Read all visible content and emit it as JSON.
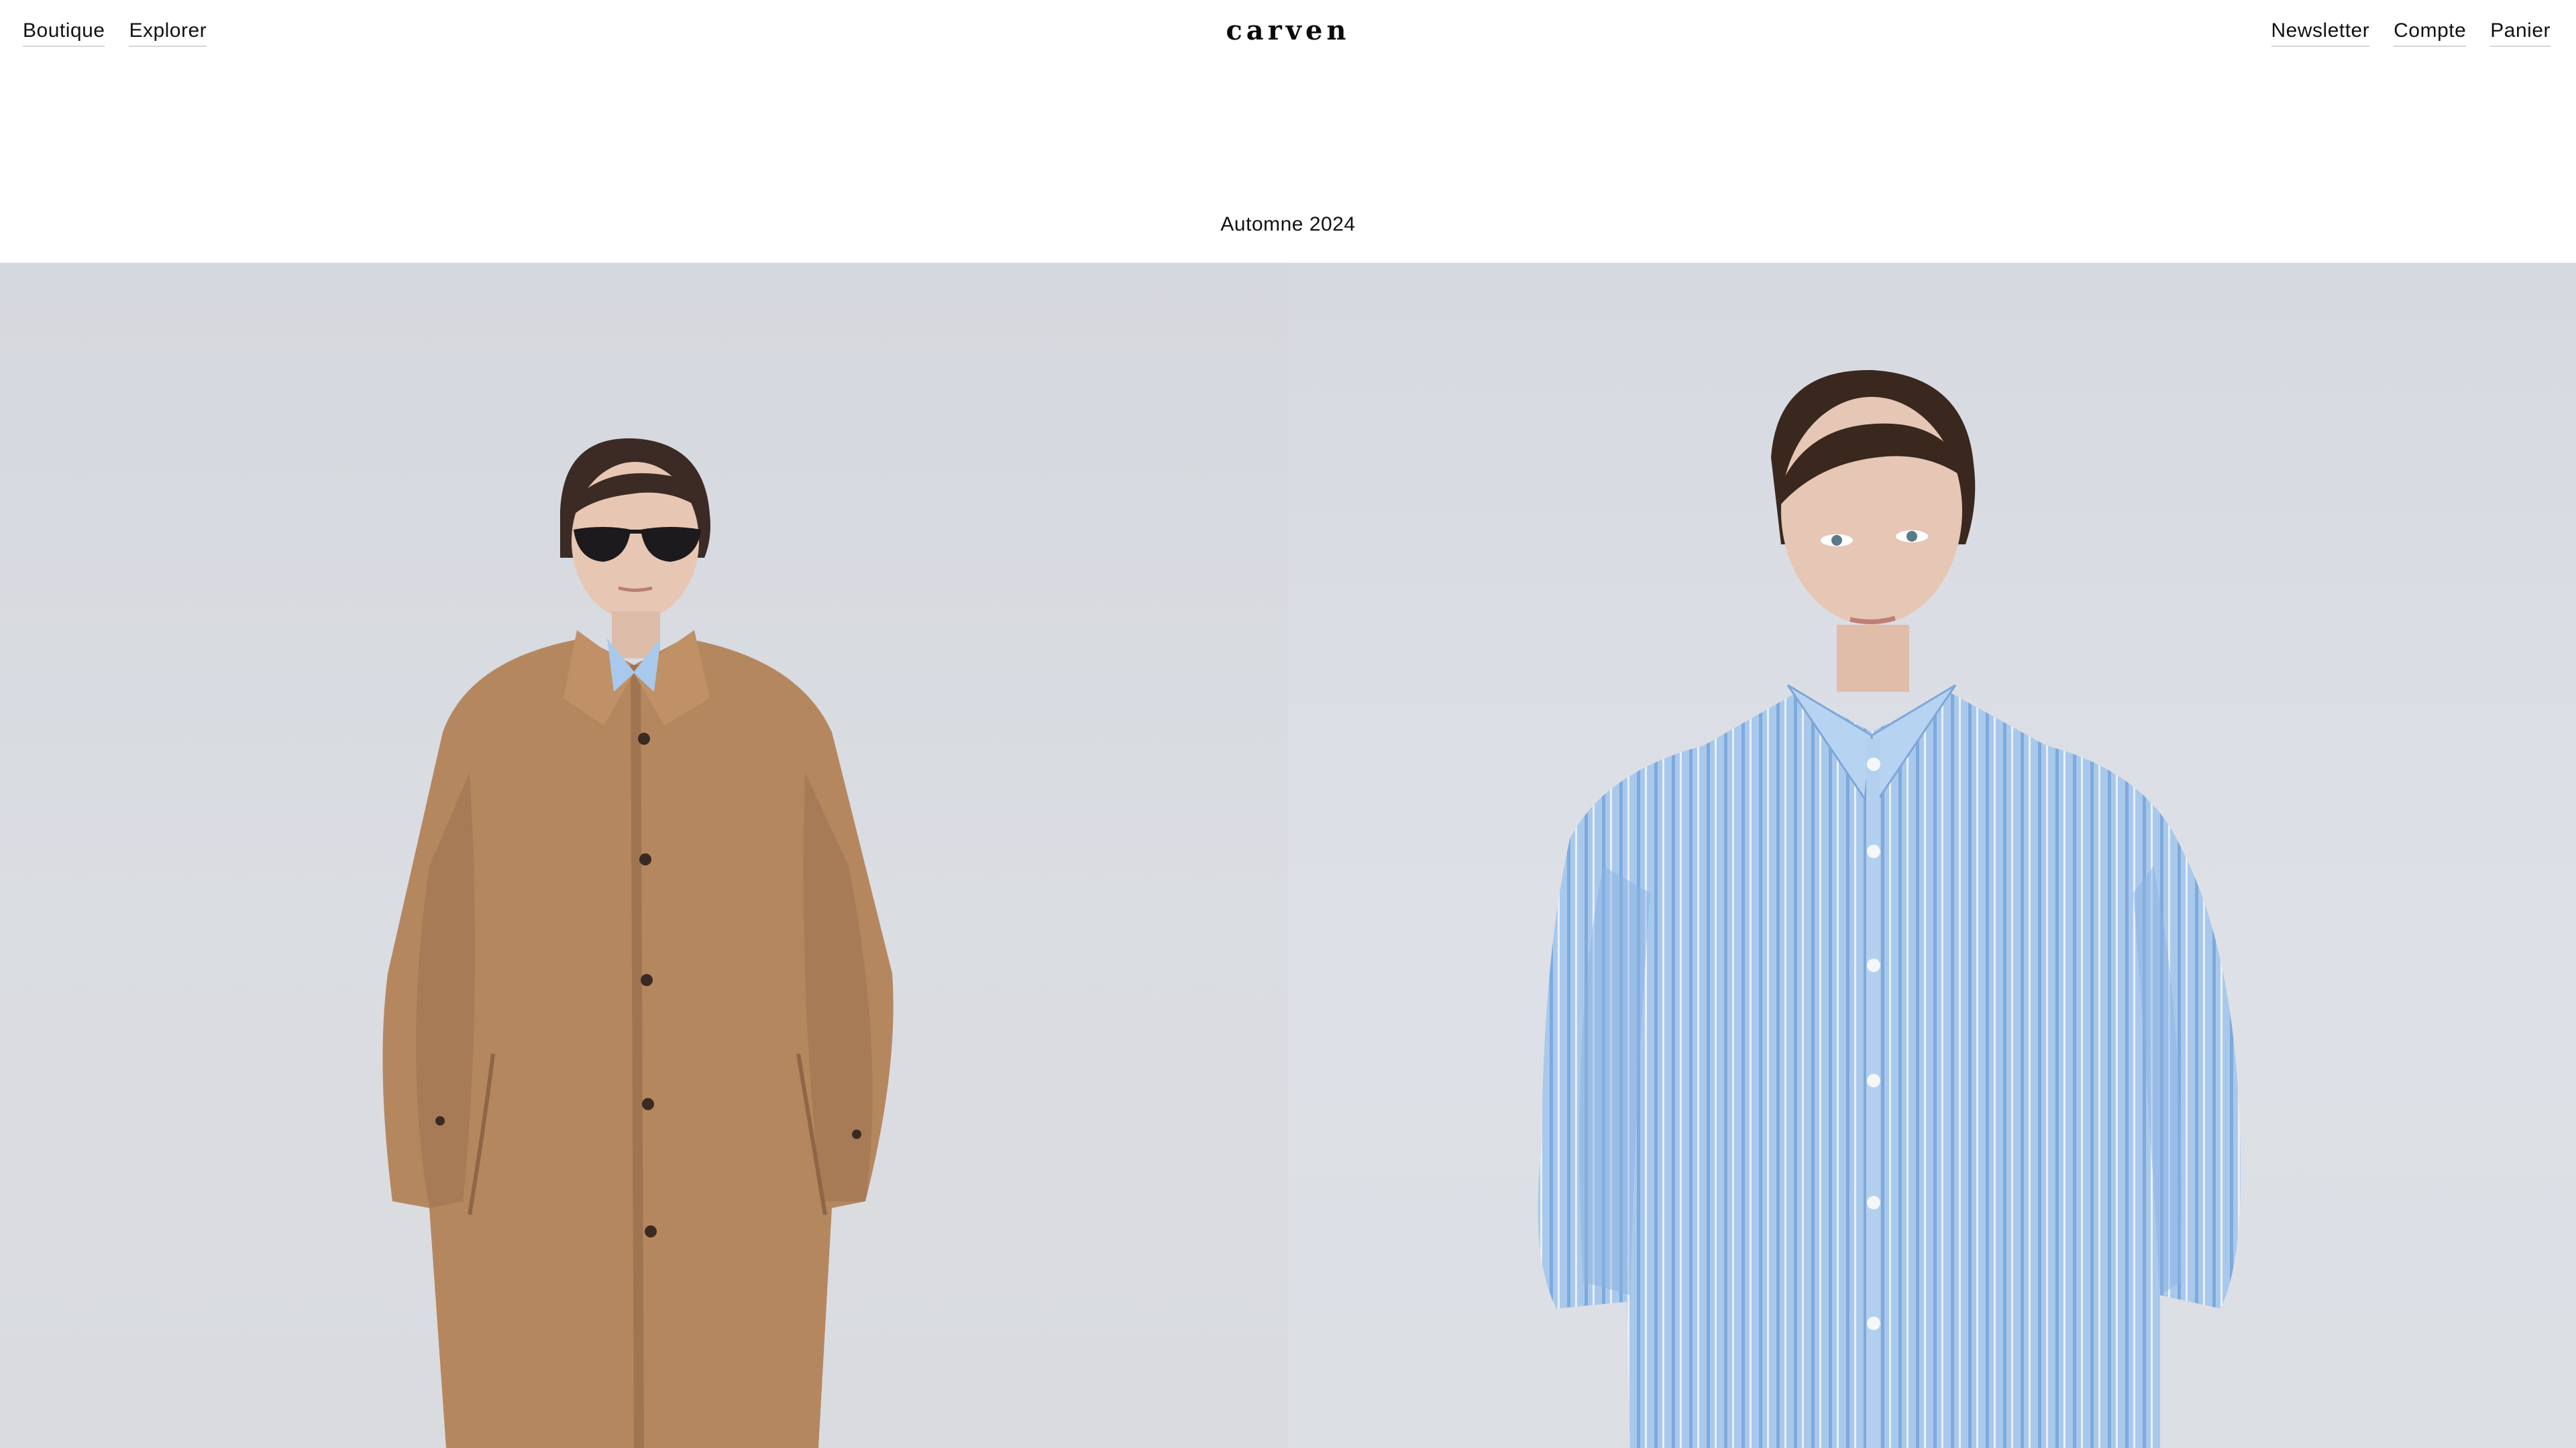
{
  "header": {
    "nav_left": [
      {
        "label": "Boutique"
      },
      {
        "label": "Explorer"
      }
    ],
    "logo": "carven",
    "nav_right": [
      {
        "label": "Newsletter"
      },
      {
        "label": "Compte"
      },
      {
        "label": "Panier"
      }
    ]
  },
  "hero": {
    "season_title": "Automne 2024",
    "images": [
      {
        "name": "model-camel-coat"
      },
      {
        "name": "model-striped-shirt"
      }
    ]
  },
  "colors": {
    "background": "#ffffff",
    "text": "#111111",
    "backdrop": "#d9dce2",
    "coat": "#b5875f",
    "shirt": "#a9c9ec"
  }
}
